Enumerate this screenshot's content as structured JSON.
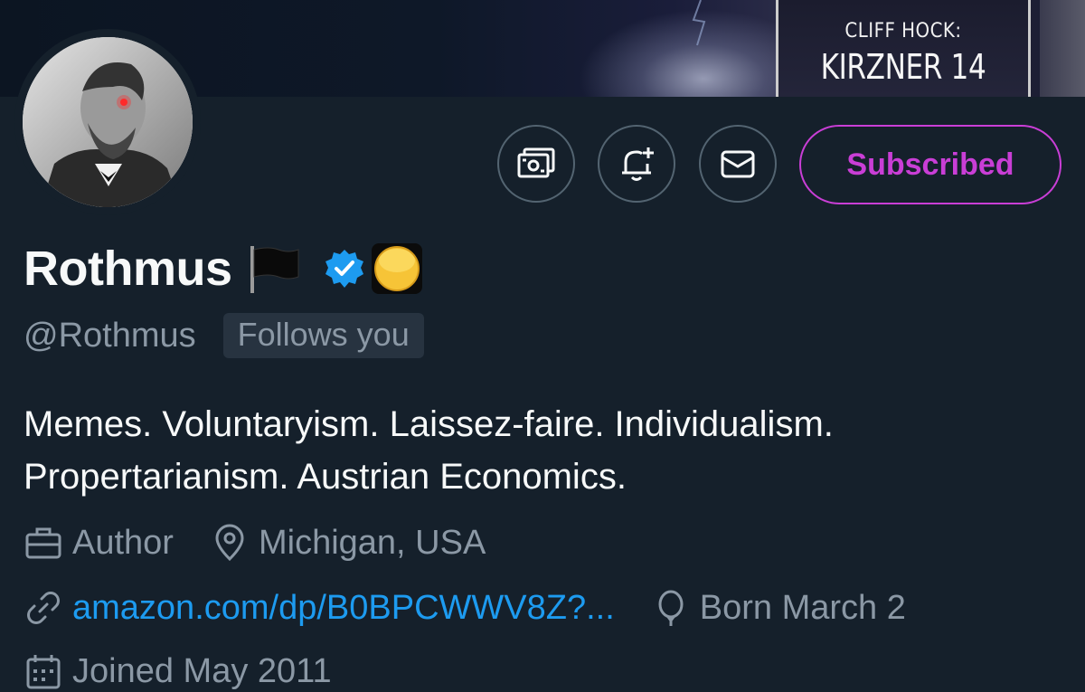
{
  "banner": {
    "book_series": "CLIFF HOCK:",
    "book_title": "KIRZNER 14"
  },
  "actions": {
    "tip_icon": "money-icon",
    "notify_icon": "bell-plus-icon",
    "message_icon": "mail-icon",
    "subscribed_label": "Subscribed"
  },
  "profile": {
    "display_name": "Rothmus",
    "handle": "@Rothmus",
    "follows_badge": "Follows you",
    "bio_line1": "Memes. Voluntaryism. Laissez-faire. Individualism.",
    "bio_line2": "Propertarianism. Austrian Economics.",
    "occupation": "Author",
    "location": "Michigan, USA",
    "website": "amazon.com/dp/B0BPCWWV8Z?...",
    "birthday": "Born March 2",
    "joined": "Joined May 2011"
  },
  "colors": {
    "background": "#15202b",
    "accent_subscribed": "#c93ed6",
    "link": "#1d9bf0",
    "muted": "#8b98a5",
    "verified": "#1d9bf0"
  }
}
